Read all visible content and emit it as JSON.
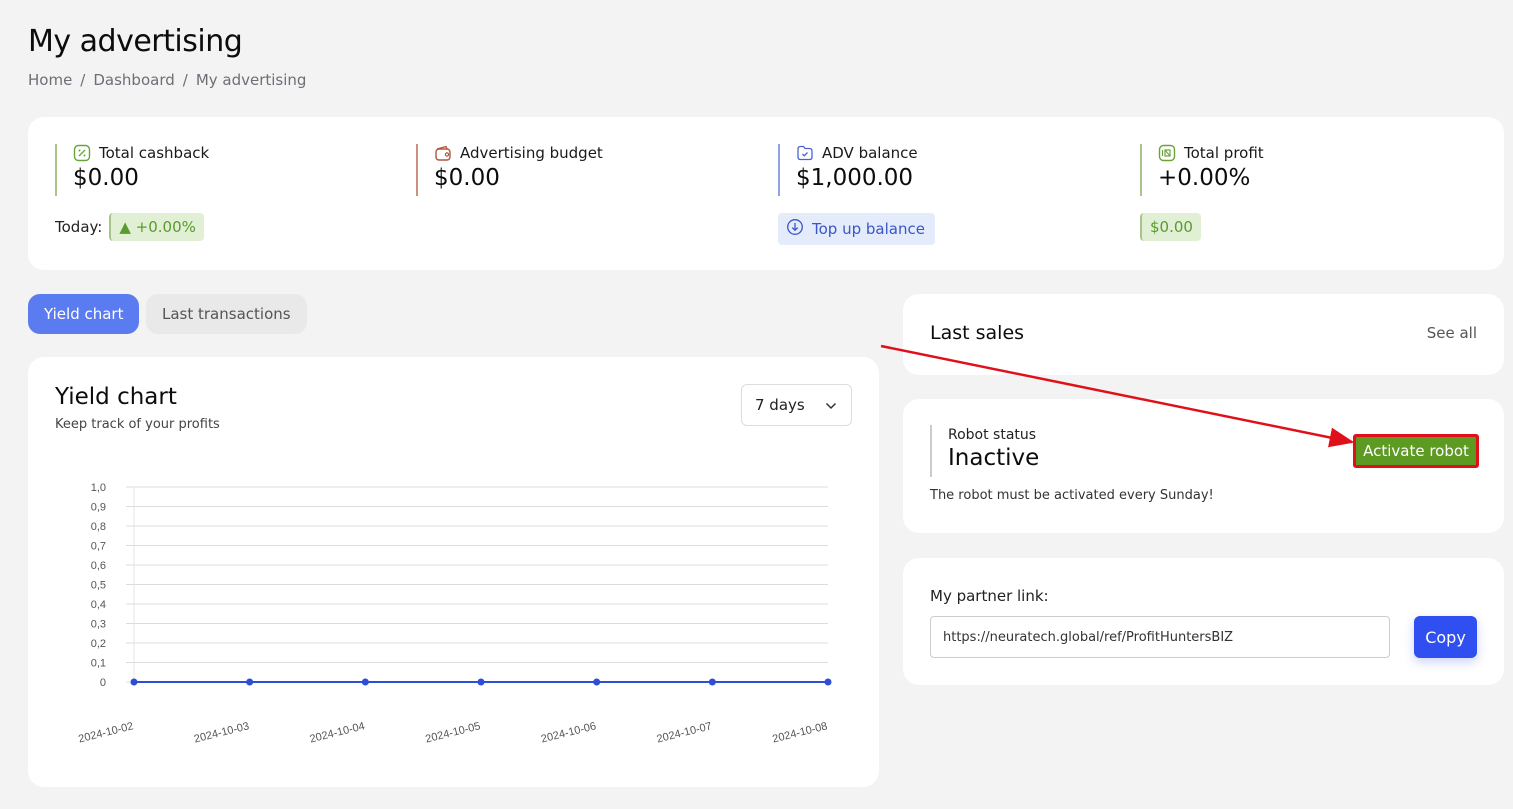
{
  "header": {
    "title": "My advertising",
    "breadcrumb": [
      "Home",
      "Dashboard",
      "My advertising"
    ],
    "separator": "/"
  },
  "stats": [
    {
      "label": "Total cashback",
      "value": "$0.00",
      "icon": "percent-icon",
      "color": "#a8c48a"
    },
    {
      "label": "Advertising budget",
      "value": "$0.00",
      "icon": "wallet-icon",
      "color": "#c9917e"
    },
    {
      "label": "ADV balance",
      "value": "$1,000.00",
      "icon": "folder-check-icon",
      "color": "#8fa3e6"
    },
    {
      "label": "Total profit",
      "value": "+0.00%",
      "icon": "profit-icon",
      "color": "#a8c48a"
    }
  ],
  "today": {
    "label": "Today:",
    "badge": "▲ +0.00%"
  },
  "topup": {
    "label": "Top up balance"
  },
  "profit_badge": "$0.00",
  "tabs": [
    {
      "label": "Yield chart",
      "active": true
    },
    {
      "label": "Last transactions",
      "active": false
    }
  ],
  "chart_card": {
    "title": "Yield chart",
    "subtitle": "Keep track of your profits",
    "range_selected": "7 days"
  },
  "chart_data": {
    "type": "line",
    "title": "Yield chart",
    "xlabel": "",
    "ylabel": "",
    "x": [
      "2024-10-02",
      "2024-10-03",
      "2024-10-04",
      "2024-10-05",
      "2024-10-06",
      "2024-10-07",
      "2024-10-08"
    ],
    "series": [
      {
        "name": "Yield",
        "values": [
          0,
          0,
          0,
          0,
          0,
          0,
          0
        ],
        "color": "#2d4fd6"
      }
    ],
    "ylim": [
      0,
      1.0
    ],
    "yticks": [
      "0",
      "0,1",
      "0,2",
      "0,3",
      "0,4",
      "0,5",
      "0,6",
      "0,7",
      "0,8",
      "0,9",
      "1,0"
    ],
    "grid": true
  },
  "last_sales": {
    "title": "Last sales",
    "see_all": "See all"
  },
  "robot": {
    "label": "Robot status",
    "status": "Inactive",
    "note": "The robot must be activated every Sunday!",
    "button": "Activate robot"
  },
  "partner": {
    "label": "My partner link:",
    "link": "https://neuratech.global/ref/ProfitHuntersBIZ",
    "copy": "Copy"
  },
  "colors": {
    "accent": "#5b7cf0",
    "primary_button": "#2f4ff0",
    "activate_button": "#5c9a22",
    "annotation": "#e0101a"
  }
}
